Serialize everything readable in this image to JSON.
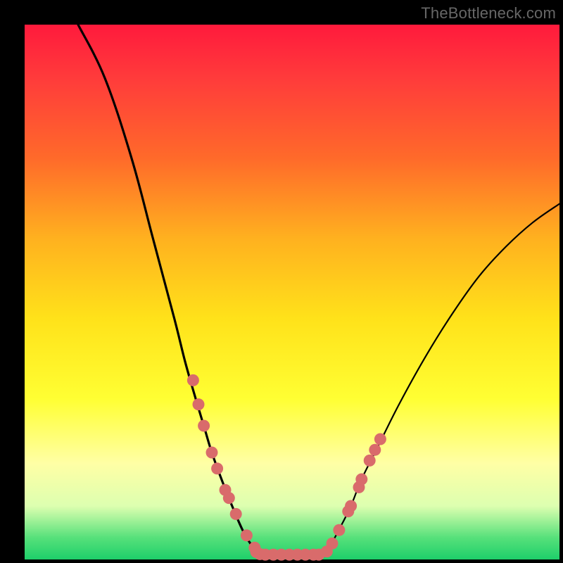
{
  "watermark": "TheBottleneck.com",
  "chart_data": {
    "type": "line",
    "title": "",
    "xlabel": "",
    "ylabel": "",
    "xlim": [
      0,
      100
    ],
    "ylim": [
      0,
      100
    ],
    "series": [
      {
        "name": "left-curve",
        "x": [
          10,
          15,
          20,
          24,
          28,
          30,
          32,
          33.5,
          35,
          37,
          39,
          41,
          43,
          45
        ],
        "y": [
          100,
          90,
          75,
          60,
          45,
          37,
          30,
          25,
          20,
          14.5,
          9.5,
          5,
          2,
          0.9
        ]
      },
      {
        "name": "right-curve",
        "x": [
          55,
          57,
          59,
          61,
          63,
          66,
          70,
          75,
          80,
          85,
          90,
          95,
          100
        ],
        "y": [
          0.9,
          2.5,
          6,
          10,
          15,
          21,
          29,
          38,
          46,
          53,
          58.5,
          63,
          66.5
        ]
      },
      {
        "name": "left-dots",
        "type": "scatter",
        "x": [
          31.5,
          32.5,
          33.5,
          35,
          36,
          37.5,
          38.2,
          39.5,
          41.5,
          43,
          43.3,
          44
        ],
        "y": [
          33.5,
          29,
          25,
          20,
          17,
          13,
          11.5,
          8.5,
          4.5,
          2.2,
          1.4,
          1.0
        ]
      },
      {
        "name": "right-dots",
        "type": "scatter",
        "x": [
          56.5,
          57.5,
          58.8,
          60.5,
          61,
          62.5,
          63,
          64.5,
          65.5,
          66.5
        ],
        "y": [
          1.5,
          3,
          5.5,
          9,
          10,
          13.5,
          15,
          18.5,
          20.5,
          22.5
        ]
      },
      {
        "name": "bottom-dots",
        "type": "scatter",
        "x": [
          45,
          46.5,
          48,
          49.5,
          51,
          52.5,
          54,
          55
        ],
        "y": [
          0.9,
          0.9,
          0.9,
          0.9,
          0.9,
          0.9,
          0.9,
          0.9
        ]
      }
    ],
    "marker_color": "#d96b6b",
    "line_color": "#000000"
  }
}
